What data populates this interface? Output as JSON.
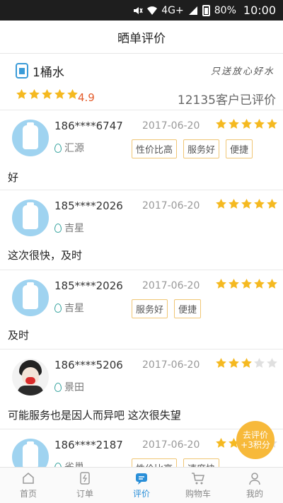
{
  "status_bar": {
    "network": "4G+",
    "battery": "80%",
    "time": "10:00"
  },
  "header": {
    "title": "晒单评价"
  },
  "shop": {
    "name": "1桶水",
    "slogan": "只送放心好水",
    "rating": "4.9",
    "rating_stars": 5,
    "review_count": "12135客户已评价"
  },
  "reviews": [
    {
      "phone": "186****6747",
      "date": "2017-06-20",
      "stars": 5,
      "location": "汇源",
      "tags": [
        "性价比高",
        "服务好",
        "便捷"
      ],
      "content": "好"
    },
    {
      "phone": "185****2026",
      "date": "2017-06-20",
      "stars": 5,
      "location": "吉星",
      "tags": [],
      "content": "这次很快，及时"
    },
    {
      "phone": "185****2026",
      "date": "2017-06-20",
      "stars": 5,
      "location": "吉星",
      "tags": [
        "服务好",
        "便捷"
      ],
      "content": "及时"
    },
    {
      "phone": "186****5206",
      "date": "2017-06-20",
      "stars": 3,
      "location": "景田",
      "tags": [],
      "content": "可能服务也是因人而异吧 这次很失望"
    },
    {
      "phone": "186****2187",
      "date": "2017-06-20",
      "stars": 3,
      "location": "雀巢",
      "tags": [
        "性价比高",
        "速度快"
      ],
      "content": ""
    }
  ],
  "fab": {
    "line1": "去评价",
    "line2": "+3积分"
  },
  "tabs": [
    {
      "label": "首页",
      "icon": "home-icon"
    },
    {
      "label": "订单",
      "icon": "order-icon"
    },
    {
      "label": "评价",
      "icon": "review-icon",
      "active": true
    },
    {
      "label": "购物车",
      "icon": "cart-icon"
    },
    {
      "label": "我的",
      "icon": "user-icon"
    }
  ],
  "colors": {
    "accent": "#2a8fd8",
    "star": "#f5b920",
    "score": "#e45c2b",
    "tag_border": "#f0c674",
    "fab": "#f7b93a"
  }
}
